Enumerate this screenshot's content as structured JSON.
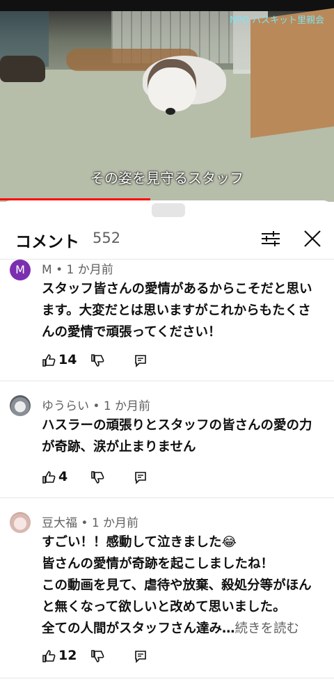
{
  "video": {
    "watermark": "NPO ハスキット里親会",
    "subtitle": "その姿を見守るスタッフ",
    "progress_fraction": 0.45,
    "progress_color": "#ff0000"
  },
  "comments_sheet": {
    "title": "コメント",
    "count": "552",
    "filter_icon": "tune-icon",
    "close_icon": "close-icon"
  },
  "comments": [
    {
      "avatar_letter": "M",
      "meta": "M • 1 か月前",
      "text": "スタッフ皆さんの愛情があるからこそだと思います。大変だとは思いますがこれからもたくさんの愛情で頑張ってください！",
      "more": "",
      "likes": "14"
    },
    {
      "avatar_letter": "",
      "meta": "ゆうらい • 1 か月前",
      "text": "ハスラーの頑張りとスタッフの皆さんの愛の力が奇跡、涙が止まりません",
      "more": "",
      "likes": "4"
    },
    {
      "avatar_letter": "",
      "meta": "豆大福 • 1 か月前",
      "text": "すごい！！感動して泣きました😂\n皆さんの愛情が奇跡を起こしましたね！\nこの動画を見て、虐待や放棄、殺処分等がほんと無くなって欲しいと改めて思いました。\n全ての人間がスタッフさん達み…",
      "more": "続きを読む",
      "likes": "12"
    }
  ]
}
